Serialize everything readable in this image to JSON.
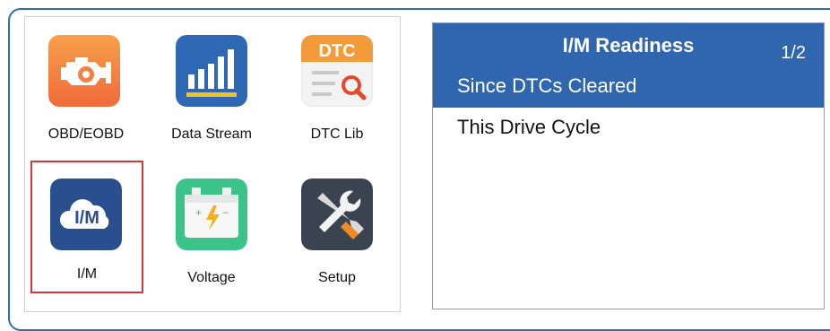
{
  "menu": {
    "items": [
      {
        "label": "OBD/EOBD",
        "icon": "engine-icon"
      },
      {
        "label": "Data Stream",
        "icon": "bar-chart-icon"
      },
      {
        "label": "DTC Lib",
        "icon": "dtc-library-icon",
        "icon_text": "DTC"
      },
      {
        "label": "I/M",
        "icon": "im-cloud-icon",
        "icon_text": "I/M",
        "highlighted": true
      },
      {
        "label": "Voltage",
        "icon": "battery-icon"
      },
      {
        "label": "Setup",
        "icon": "tools-icon"
      }
    ]
  },
  "screen": {
    "title": "I/M Readiness",
    "page": "1/2",
    "options": [
      {
        "label": "Since DTCs Cleared",
        "selected": true
      },
      {
        "label": "This Drive Cycle",
        "selected": false
      }
    ]
  },
  "colors": {
    "frame": "#2a6fb7",
    "header": "#2f66ad",
    "highlight_border": "#d0393b"
  }
}
